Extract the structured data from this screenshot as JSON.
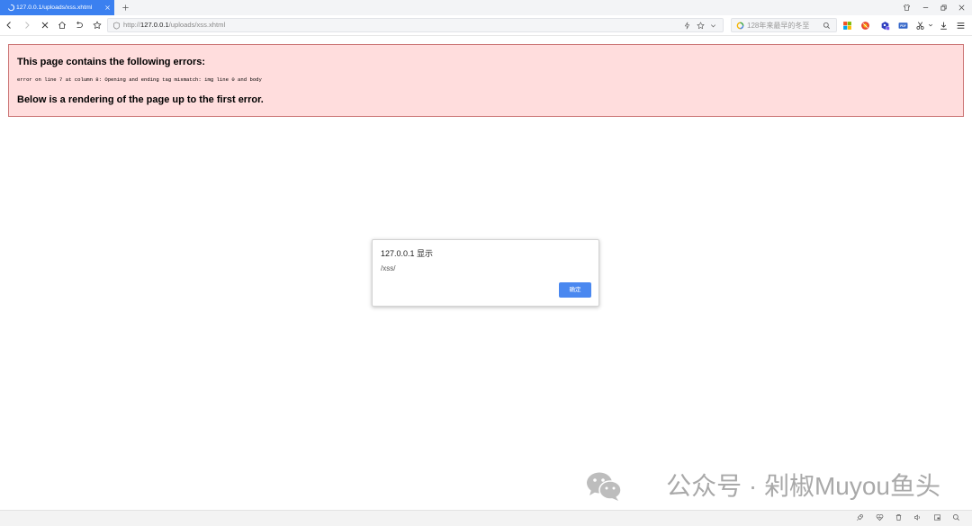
{
  "browser": {
    "active_tab": {
      "title": "127.0.0.1/uploads/xss.xhtml",
      "icon": "loading-spinner-icon"
    },
    "window_controls": [
      "skin-icon",
      "minimize-icon",
      "restore-icon",
      "close-icon"
    ],
    "nav_icons": [
      "back-icon",
      "forward-icon",
      "stop-icon",
      "home-icon",
      "undo-icon",
      "favorites-icon"
    ],
    "address_bar": {
      "scheme": "http://",
      "host": "127.0.0.1",
      "path": "/uploads/xss.xhtml",
      "icons": [
        "security-shield-icon",
        "lightning-icon",
        "bookmark-star-icon",
        "chevron-down-icon"
      ]
    },
    "search_box": {
      "placeholder": "128年来最早的冬至",
      "icons": [
        "search-engine-icon",
        "search-icon"
      ]
    },
    "extensions": {
      "icons": [
        "apps-grid-icon",
        "red-extension-icon",
        "blue-extension-icon",
        "pdf-icon",
        "scissors-icon",
        "download-icon",
        "menu-icon"
      ],
      "pdf_label": "PDF"
    },
    "status_bar_icons": [
      "rocket-icon",
      "heart-icon",
      "trash-icon",
      "speaker-icon",
      "pip-window-icon",
      "zoom-icon"
    ]
  },
  "xml_error": {
    "heading": "This page contains the following errors:",
    "detail": "error on line 7 at column 8: Opening and ending tag mismatch: img line 0 and body",
    "footer": "Below is a rendering of the page up to the first error."
  },
  "alert_dialog": {
    "origin_title": "127.0.0.1 显示",
    "message": "/xss/",
    "ok_button": "确定"
  },
  "watermark": {
    "icon": "wechat-icon",
    "text": "公众号 · 剁椒Muyou鱼头"
  },
  "colors": {
    "active_tab": "#3b80f0",
    "error_background": "#ffdddd",
    "error_border": "#cc7777",
    "dialog_button": "#4a88f0",
    "watermark": "#a9a9a9"
  }
}
